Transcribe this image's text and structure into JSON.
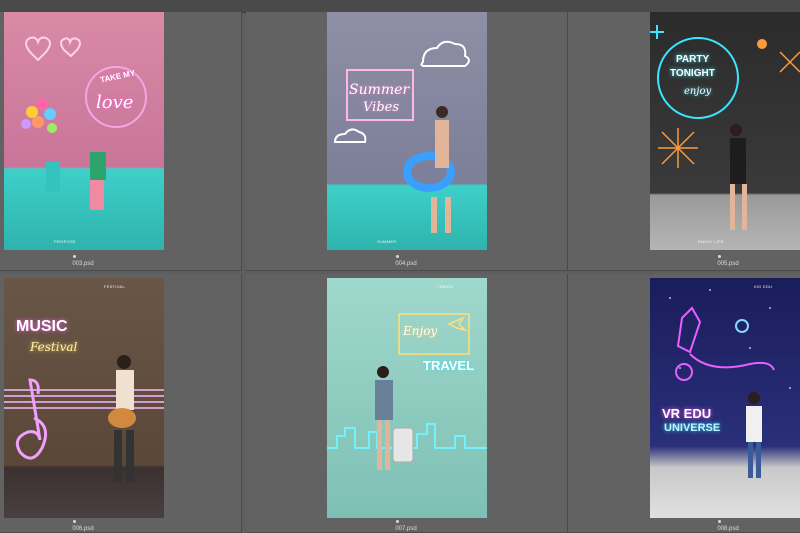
{
  "thumbnails": [
    {
      "file": "003.psd",
      "caption": "PROPOSE",
      "neon_top": "TAKE MY",
      "neon_main": "love"
    },
    {
      "file": "004.psd",
      "caption": "SUMMER",
      "neon_top": "Summer",
      "neon_main": "Vibes"
    },
    {
      "file": "005.psd",
      "caption": "ENJOY LIFE",
      "neon_top": "PARTY",
      "neon_mid": "TONIGHT",
      "neon_main": "enjoy"
    },
    {
      "file": "006.psd",
      "caption": "FESTIVAL",
      "neon_top": "MUSIC",
      "neon_main": "Festival"
    },
    {
      "file": "007.psd",
      "caption": "TRAVEL",
      "neon_top": "Enjoy",
      "neon_main": "TRAVEL"
    },
    {
      "file": "008.psd",
      "caption": "KID EDU",
      "neon_top": "VR EDU",
      "neon_main": "UNIVERSE"
    }
  ],
  "colors": {
    "panel": "#626262",
    "toolbar": "#4a4a4a",
    "label": "#dcdcdc"
  }
}
